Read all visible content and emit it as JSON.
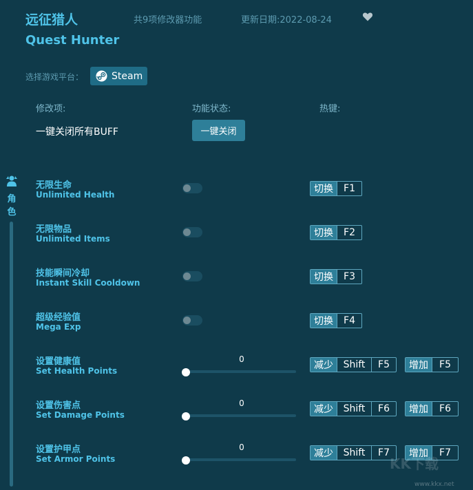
{
  "header": {
    "title_cn": "远征猎人",
    "feature_count": "共9项修改器功能",
    "update_date": "更新日期:2022-08-24",
    "favorite_icon": "heart-icon",
    "title_en": "Quest Hunter"
  },
  "platform": {
    "label": "选择游戏平台：",
    "button_label": "Steam",
    "icon": "steam-icon"
  },
  "columns": {
    "item": "修改项:",
    "status": "功能状态:",
    "hotkey": "热键:"
  },
  "global": {
    "label": "一键关闭所有BUFF",
    "button_label": "一键关闭"
  },
  "category": {
    "label": "角色",
    "icon": "character-icon"
  },
  "toggles": [
    {
      "cn": "无限生命",
      "en": "Unlimited Health",
      "on": false,
      "action": "切换",
      "key": "F1"
    },
    {
      "cn": "无限物品",
      "en": "Unlimited Items",
      "on": false,
      "action": "切换",
      "key": "F2"
    },
    {
      "cn": "技能瞬间冷却",
      "en": "Instant Skill Cooldown",
      "on": false,
      "action": "切换",
      "key": "F3"
    },
    {
      "cn": "超级经验值",
      "en": "Mega Exp",
      "on": false,
      "action": "切换",
      "key": "F4"
    }
  ],
  "sliders": [
    {
      "cn": "设置健康值",
      "en": "Set Health Points",
      "value": "0",
      "level": 0,
      "dec_action": "减少",
      "dec_mod": "Shift",
      "dec_key": "F5",
      "inc_action": "增加",
      "inc_key": "F5"
    },
    {
      "cn": "设置伤害点",
      "en": "Set Damage Points",
      "value": "0",
      "level": 0,
      "dec_action": "减少",
      "dec_mod": "Shift",
      "dec_key": "F6",
      "inc_action": "增加",
      "inc_key": "F6"
    },
    {
      "cn": "设置护甲点",
      "en": "Set Armor Points",
      "value": "0",
      "level": 0,
      "dec_action": "减少",
      "dec_mod": "Shift",
      "dec_key": "F7",
      "inc_action": "增加",
      "inc_key": "F7"
    }
  ],
  "watermark": {
    "logo_text": "KK下载",
    "url": "www.kkx.net"
  },
  "colors": {
    "background": "#0f3a4a",
    "accent": "#4fc3e8",
    "button": "#2e7f99"
  }
}
